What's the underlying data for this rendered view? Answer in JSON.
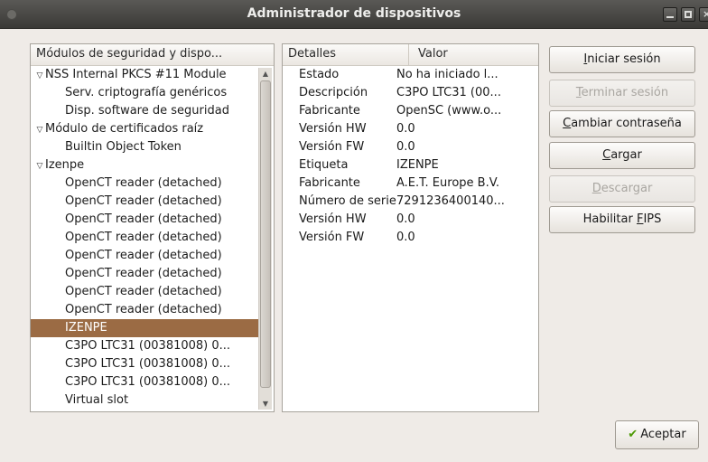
{
  "window": {
    "title": "Administrador de dispositivos"
  },
  "tree": {
    "header": "Módulos de seguridad y dispo...",
    "rows": [
      {
        "label": "NSS Internal PKCS #11 Module",
        "level": 0,
        "expander": "▽",
        "selected": false
      },
      {
        "label": "Serv. criptografía genéricos",
        "level": 1,
        "expander": "",
        "selected": false
      },
      {
        "label": "Disp. software de seguridad",
        "level": 1,
        "expander": "",
        "selected": false
      },
      {
        "label": "Módulo de certificados raíz",
        "level": 0,
        "expander": "▽",
        "selected": false
      },
      {
        "label": "Builtin Object Token",
        "level": 1,
        "expander": "",
        "selected": false
      },
      {
        "label": "Izenpe",
        "level": 0,
        "expander": "▽",
        "selected": false
      },
      {
        "label": "OpenCT reader (detached)",
        "level": 1,
        "expander": "",
        "selected": false
      },
      {
        "label": "OpenCT reader (detached)",
        "level": 1,
        "expander": "",
        "selected": false
      },
      {
        "label": "OpenCT reader (detached)",
        "level": 1,
        "expander": "",
        "selected": false
      },
      {
        "label": "OpenCT reader (detached)",
        "level": 1,
        "expander": "",
        "selected": false
      },
      {
        "label": "OpenCT reader (detached)",
        "level": 1,
        "expander": "",
        "selected": false
      },
      {
        "label": "OpenCT reader (detached)",
        "level": 1,
        "expander": "",
        "selected": false
      },
      {
        "label": "OpenCT reader (detached)",
        "level": 1,
        "expander": "",
        "selected": false
      },
      {
        "label": "OpenCT reader (detached)",
        "level": 1,
        "expander": "",
        "selected": false
      },
      {
        "label": "IZENPE",
        "level": 1,
        "expander": "",
        "selected": true
      },
      {
        "label": "C3PO LTC31 (00381008) 0...",
        "level": 1,
        "expander": "",
        "selected": false
      },
      {
        "label": "C3PO LTC31 (00381008) 0...",
        "level": 1,
        "expander": "",
        "selected": false
      },
      {
        "label": "C3PO LTC31 (00381008) 0...",
        "level": 1,
        "expander": "",
        "selected": false
      },
      {
        "label": "Virtual slot",
        "level": 1,
        "expander": "",
        "selected": false
      }
    ]
  },
  "details": {
    "header_key": "Detalles",
    "header_value": "Valor",
    "rows": [
      {
        "k": "Estado",
        "v": "No ha iniciado l..."
      },
      {
        "k": "Descripción",
        "v": "C3PO LTC31 (00..."
      },
      {
        "k": "Fabricante",
        "v": "OpenSC (www.o..."
      },
      {
        "k": "Versión HW",
        "v": "0.0"
      },
      {
        "k": "Versión FW",
        "v": "0.0"
      },
      {
        "k": "Etiqueta",
        "v": "IZENPE"
      },
      {
        "k": "Fabricante",
        "v": "A.E.T. Europe B.V."
      },
      {
        "k": "Número de serie",
        "v": "7291236400140..."
      },
      {
        "k": "Versión HW",
        "v": "0.0"
      },
      {
        "k": "Versión FW",
        "v": "0.0"
      }
    ]
  },
  "buttons": {
    "login": {
      "pre": "",
      "mn": "I",
      "post": "niciar sesión"
    },
    "logout": {
      "pre": "",
      "mn": "T",
      "post": "erminar sesión"
    },
    "change_password": {
      "pre": "",
      "mn": "C",
      "post": "ambiar contraseña"
    },
    "load": {
      "pre": "",
      "mn": "C",
      "post": "argar"
    },
    "unload": {
      "pre": "",
      "mn": "D",
      "post": "escargar"
    },
    "enable_fips": {
      "pre": "Habilitar ",
      "mn": "F",
      "post": "IPS"
    },
    "accept": {
      "label": "Aceptar"
    }
  }
}
